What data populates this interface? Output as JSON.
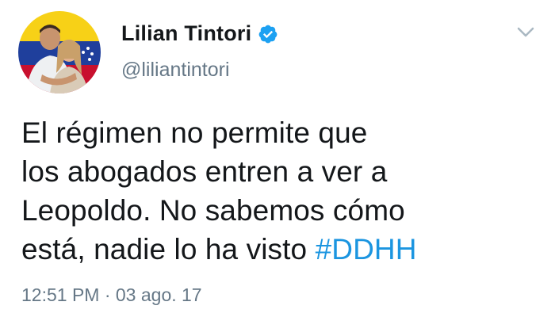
{
  "tweet": {
    "display_name": "Lilian Tintori",
    "handle": "@liliantintori",
    "verified": true,
    "text_lines": [
      "El régimen no permite que",
      "los abogados entren a ver a",
      "Leopoldo. No sabemos cómo",
      "está, nadie lo ha visto "
    ],
    "hashtag": "#DDHH",
    "timestamp": "12:51 PM · 03 ago. 17"
  },
  "icons": {
    "verified": "verified-badge-icon",
    "menu": "chevron-down-icon"
  },
  "colors": {
    "text": "#14171a",
    "secondary": "#657786",
    "link": "#1b95e0",
    "verified": "#1da1f2"
  }
}
